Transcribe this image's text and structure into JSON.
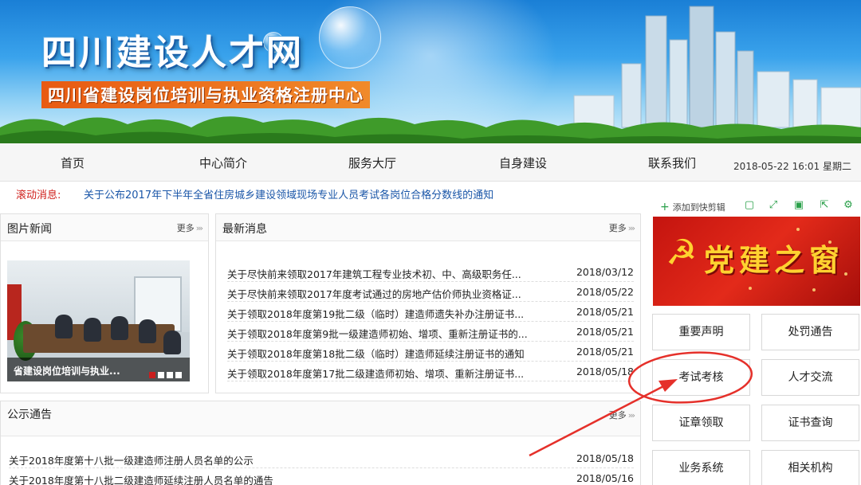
{
  "banner": {
    "title": "四川建设人才网",
    "subtitle": "四川省建设岗位培训与执业资格注册中心"
  },
  "nav": {
    "items": [
      "首页",
      "中心简介",
      "服务大厅",
      "自身建设",
      "联系我们"
    ],
    "datetime": "2018-05-22 16:01 星期二"
  },
  "ticker": {
    "label": "滚动消息:",
    "text": "关于公布2017年下半年全省住房城乡建设领域现场专业人员考试各岗位合格分数线的通知"
  },
  "photo_news": {
    "title": "图片新闻",
    "more": "更多",
    "caption": "省建设岗位培训与执业..."
  },
  "latest": {
    "title": "最新消息",
    "more": "更多",
    "items": [
      {
        "title": "关于尽快前来领取2017年建筑工程专业技术初、中、高级职务任...",
        "date": "2018/03/12"
      },
      {
        "title": "关于尽快前来领取2017年度考试通过的房地产估价师执业资格证...",
        "date": "2018/05/22"
      },
      {
        "title": "关于领取2018年度第19批二级（临时）建造师遗失补办注册证书...",
        "date": "2018/05/21"
      },
      {
        "title": "关于领取2018年度第9批一级建造师初始、增项、重新注册证书的...",
        "date": "2018/05/21"
      },
      {
        "title": "关于领取2018年度第18批二级（临时）建造师延续注册证书的通知",
        "date": "2018/05/21"
      },
      {
        "title": "关于领取2018年度第17批二级建造师初始、增项、重新注册证书...",
        "date": "2018/05/18"
      }
    ]
  },
  "notice": {
    "title": "公示通告",
    "more": "更多",
    "items": [
      {
        "title": "关于2018年度第十八批一级建造师注册人员名单的公示",
        "date": "2018/05/18"
      },
      {
        "title": "关于2018年度第十八批二级建造师延续注册人员名单的通告",
        "date": "2018/05/16"
      }
    ]
  },
  "toolbar": {
    "add_label": "添加到快剪辑",
    "icons": [
      "copy-icon",
      "expand-icon",
      "screen-icon",
      "share-icon",
      "gear-icon"
    ]
  },
  "party": {
    "text": "党建之窗"
  },
  "quick_links": [
    "重要声明",
    "处罚通告",
    "考试考核",
    "人才交流",
    "证章领取",
    "证书查询",
    "业务系统",
    "相关机构"
  ],
  "colors": {
    "accent_red": "#d0201c",
    "annotation_red": "#e5302a",
    "link_blue": "#1a56a8",
    "party_red": "#c4140f",
    "party_gold": "#ffd230"
  }
}
